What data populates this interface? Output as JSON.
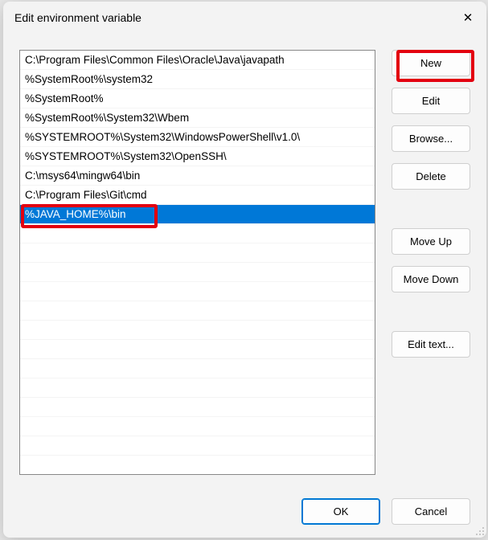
{
  "title": "Edit environment variable",
  "entries": [
    "C:\\Program Files\\Common Files\\Oracle\\Java\\javapath",
    "%SystemRoot%\\system32",
    "%SystemRoot%",
    "%SystemRoot%\\System32\\Wbem",
    "%SYSTEMROOT%\\System32\\WindowsPowerShell\\v1.0\\",
    "%SYSTEMROOT%\\System32\\OpenSSH\\",
    "C:\\msys64\\mingw64\\bin",
    "C:\\Program Files\\Git\\cmd",
    "%JAVA_HOME%\\bin"
  ],
  "selectedIndex": 8,
  "totalRows": 21,
  "buttons": {
    "new": "New",
    "edit": "Edit",
    "browse": "Browse...",
    "delete": "Delete",
    "moveUp": "Move Up",
    "moveDown": "Move Down",
    "editText": "Edit text...",
    "ok": "OK",
    "cancel": "Cancel"
  }
}
